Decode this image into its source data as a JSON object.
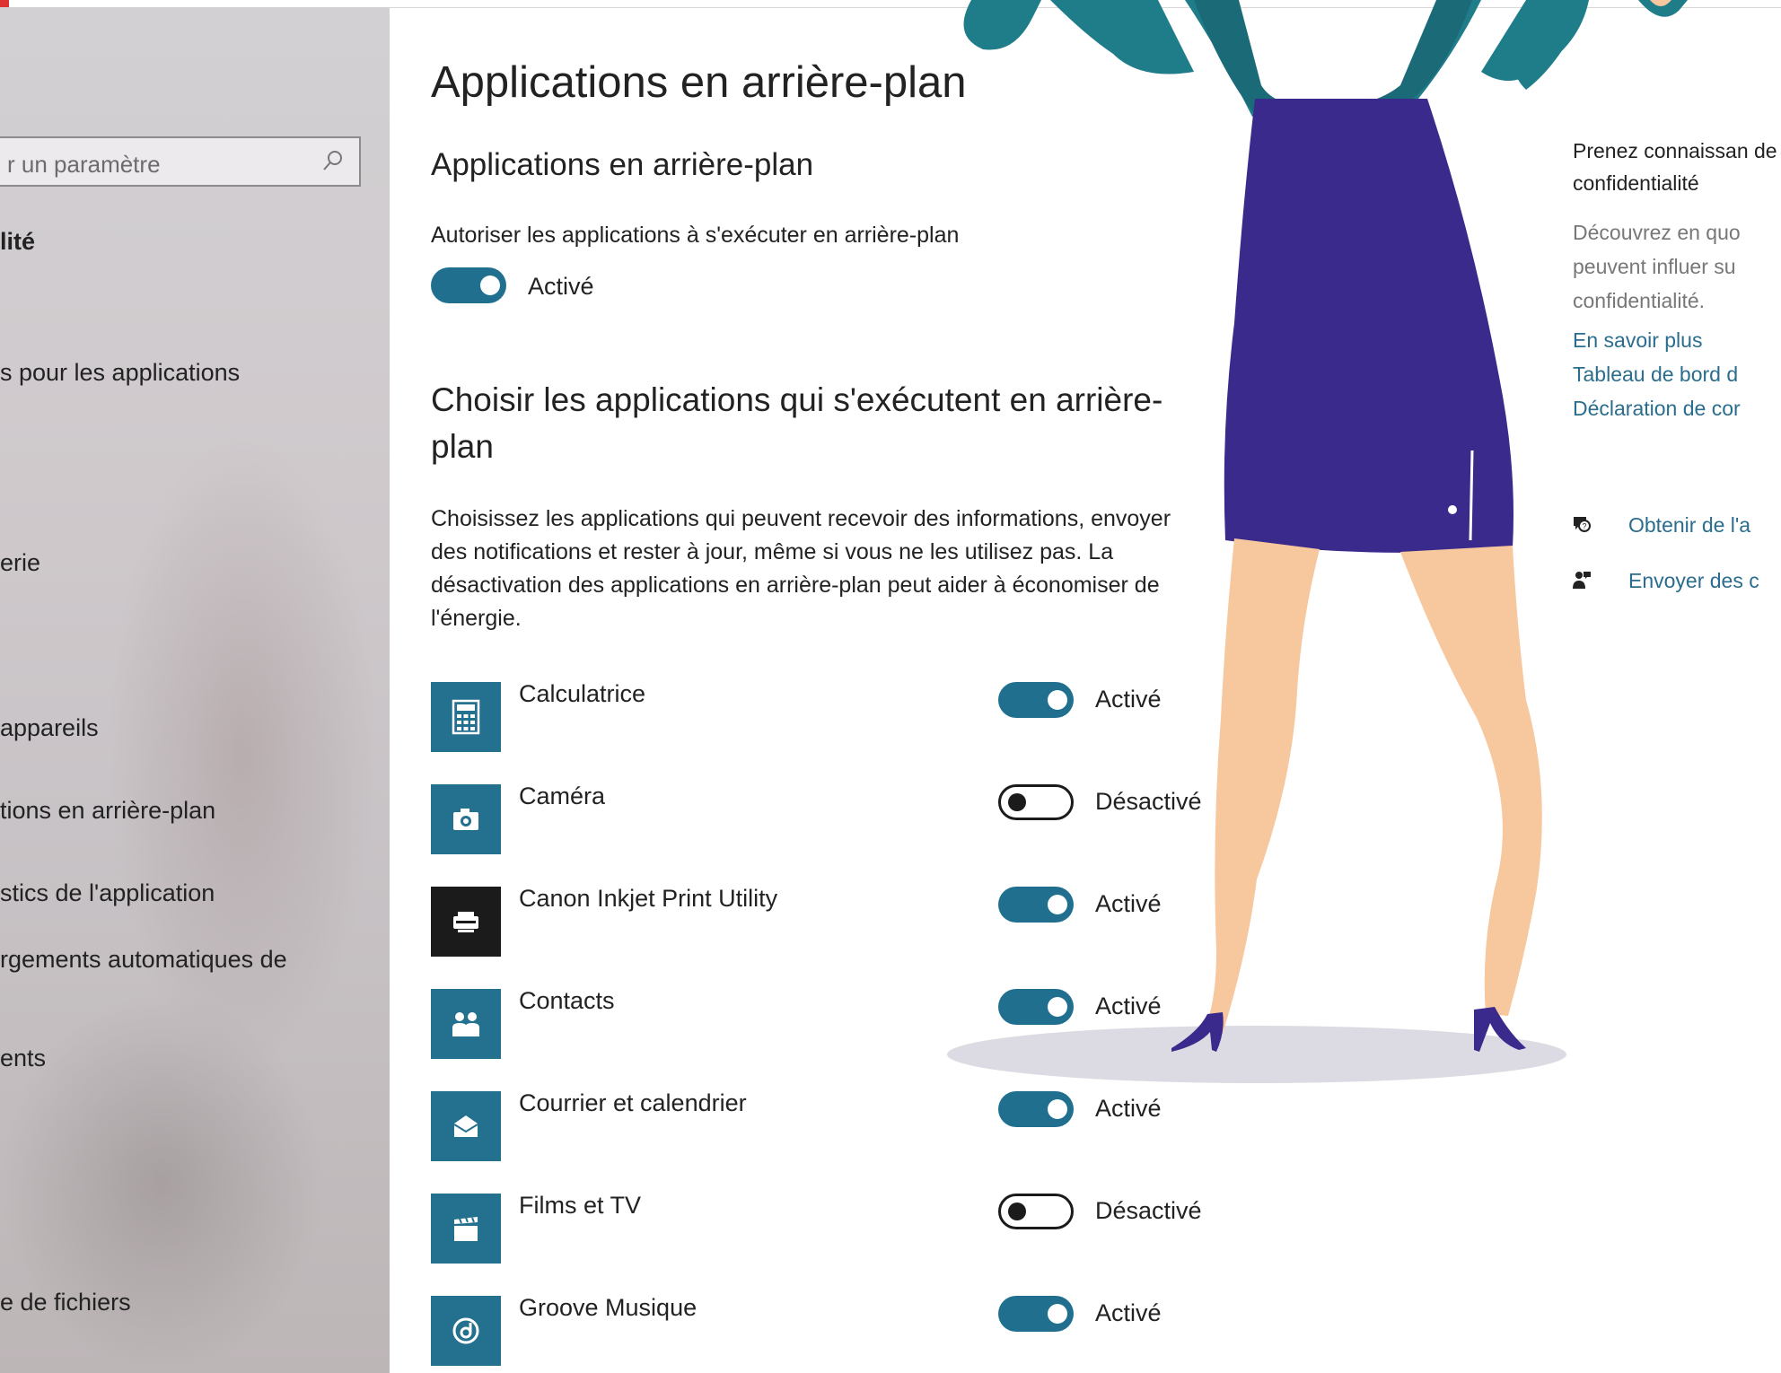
{
  "search": {
    "placeholder": "r un paramètre"
  },
  "sidebar": {
    "items": [
      {
        "label": "lité"
      },
      {
        "label": "s pour les applications"
      },
      {
        "label": "erie"
      },
      {
        "label": "appareils"
      },
      {
        "label": "tions en arrière-plan"
      },
      {
        "label": "stics de l'application"
      },
      {
        "label": "rgements automatiques de"
      },
      {
        "label": "ents"
      },
      {
        "label": "e de fichiers"
      }
    ]
  },
  "main": {
    "page_title": "Applications en arrière-plan",
    "section_title": "Applications en arrière-plan",
    "allow_label": "Autoriser les applications à s'exécuter en arrière-plan",
    "allow_state": "Activé",
    "choose_title": "Choisir les applications qui s'exécutent en arrière-plan",
    "choose_desc": "Choisissez les applications qui peuvent recevoir des informations, envoyer des notifications et rester à jour, même si vous ne les utilisez pas. La désactivation des applications en arrière-plan peut aider à économiser de l'énergie.",
    "apps": [
      {
        "name": "Calculatrice",
        "state": "Activé",
        "on": true,
        "icon": "calculator-icon"
      },
      {
        "name": "Caméra",
        "state": "Désactivé",
        "on": false,
        "icon": "camera-icon"
      },
      {
        "name": "Canon Inkjet Print Utility",
        "state": "Activé",
        "on": true,
        "icon": "printer-icon"
      },
      {
        "name": "Contacts",
        "state": "Activé",
        "on": true,
        "icon": "contacts-icon"
      },
      {
        "name": "Courrier et calendrier",
        "state": "Activé",
        "on": true,
        "icon": "mail-icon"
      },
      {
        "name": "Films et TV",
        "state": "Désactivé",
        "on": false,
        "icon": "clapperboard-icon"
      },
      {
        "name": "Groove Musique",
        "state": "Activé",
        "on": true,
        "icon": "music-icon"
      }
    ]
  },
  "right_panel": {
    "title": "Prenez connaissan de confidentialité",
    "desc": "Découvrez en quo peuvent influer su confidentialité.",
    "links": [
      "En savoir plus",
      "Tableau de bord d",
      "Déclaration de cor"
    ],
    "help": [
      {
        "label": "Obtenir de l'a",
        "icon": "chat-help-icon"
      },
      {
        "label": "Envoyer des c",
        "icon": "feedback-person-icon"
      }
    ]
  },
  "colors": {
    "accent": "#206f8f",
    "link": "#2a6d8e",
    "skirt": "#3a2a8c",
    "jacket": "#1f7d8a",
    "skin": "#f7c79e"
  }
}
